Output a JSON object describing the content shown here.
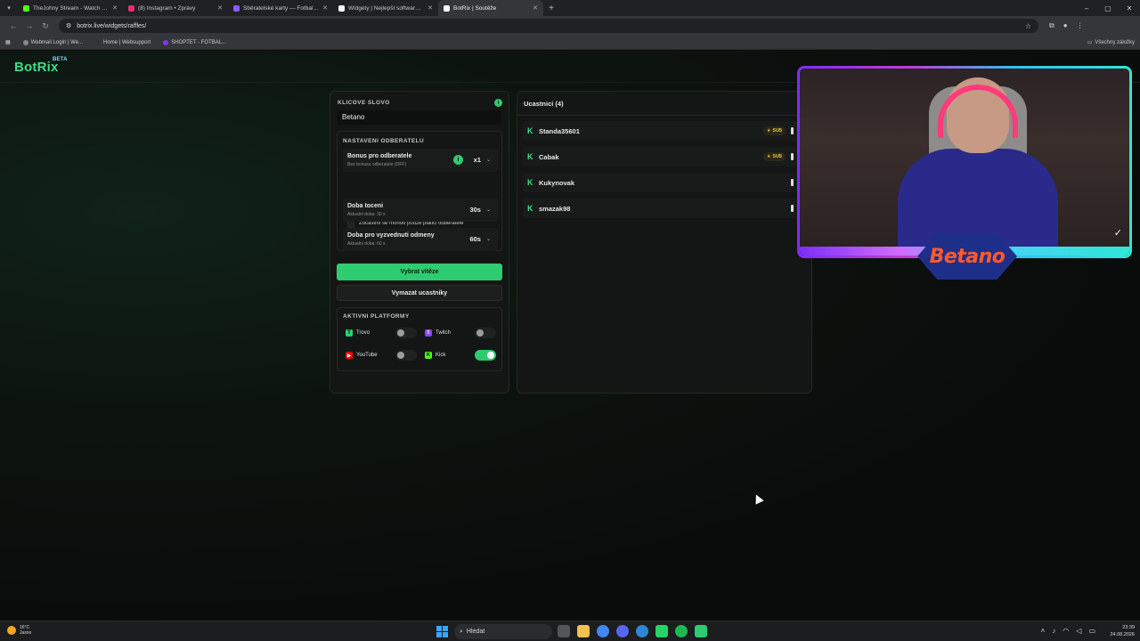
{
  "browser": {
    "tabs": [
      {
        "title": "TheJohny Stream - Watch Live",
        "favicon_color": "#53fc18",
        "active": false
      },
      {
        "title": "(8) Instagram • Zprávy",
        "favicon_color": "#e1306c",
        "active": false
      },
      {
        "title": "Sběratelské karty — Fotbalovey",
        "favicon_color": "#8b5cf6",
        "active": false
      },
      {
        "title": "Widgety | Nejlepší software pro",
        "favicon_color": "#ffffff",
        "active": false
      },
      {
        "title": "BotRix | Soutěže",
        "favicon_color": "#ffffff",
        "active": true
      }
    ],
    "url": "botrix.live/widgets/raffles/",
    "bookmarks": [
      {
        "label": "Webmail Login | We...",
        "color": "#888888"
      },
      {
        "label": "Home | Websupport",
        "color": "#333333"
      },
      {
        "label": "SHOPTET - FOTBAL...",
        "color": "#7c3aed"
      }
    ],
    "bookmarks_right": "Všechny záložky"
  },
  "app": {
    "logo": "BotRix",
    "logo_badge": "BETA",
    "accent": "#2ecc71"
  },
  "raffle": {
    "keyword_title": "KLICOVE SLOVO",
    "keyword_value": "Betano",
    "subs_title": "NASTAVENI ODBERATELU",
    "bonus_label": "Bonus pro odberatele",
    "bonus_sub": "Bez bonusu odberatele (OFF)",
    "bonus_value": "x1",
    "subs_only_label": "Zucastnit se mohou pouze platici odberatele",
    "spin_label": "Doba toceni",
    "spin_sub": "Aktualni doba: 30 s",
    "spin_value": "30s",
    "claim_label": "Doba pro vyzvednuti odmeny",
    "claim_sub": "Aktualni doba: 60 s",
    "claim_value": "60s",
    "pick_button": "Vybrat vítěze",
    "clear_button": "Vymazat ucastniky",
    "platforms_title": "AKTIVNI PLATFORMY",
    "platforms": [
      {
        "name": "Trovo",
        "icon": "trovo-icon",
        "color": "#1bd96a",
        "enabled": false
      },
      {
        "name": "Twitch",
        "icon": "twitch-icon",
        "color": "#9146ff",
        "enabled": false
      },
      {
        "name": "YouTube",
        "icon": "youtube-icon",
        "color": "#ff0000",
        "enabled": false
      },
      {
        "name": "Kick",
        "icon": "kick-icon",
        "color": "#53fc18",
        "enabled": true
      }
    ]
  },
  "participants": {
    "title": "Ucastnici (4)",
    "list": [
      {
        "name": "Standa35601",
        "badge": "SUB"
      },
      {
        "name": "Cabak",
        "badge": "SUB"
      },
      {
        "name": "Kukynovak",
        "badge": ""
      },
      {
        "name": "smazak98",
        "badge": ""
      }
    ]
  },
  "overlay": {
    "sponsor": "Betano"
  },
  "taskbar": {
    "weather_temp": "16°C",
    "weather_desc": "Jasno",
    "search_placeholder": "Hledat",
    "time": "23:39",
    "date": "24.08.2026"
  }
}
